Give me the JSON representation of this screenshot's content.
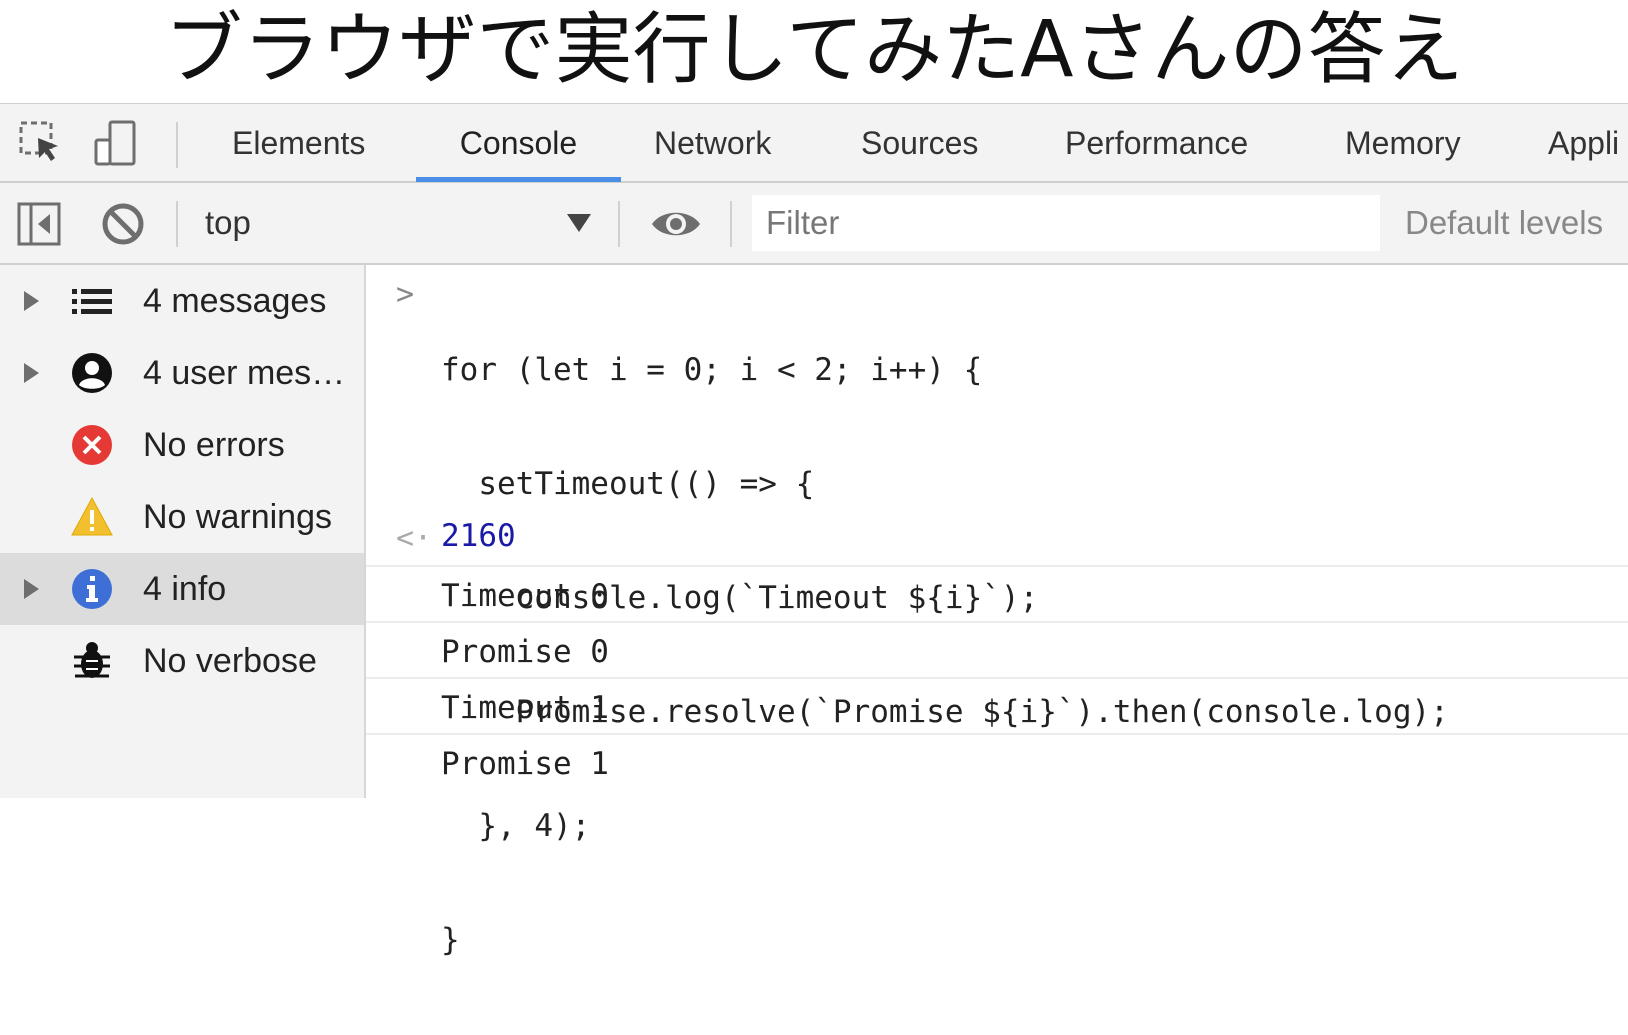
{
  "slide": {
    "title": "ブラウザで実行してみたAさんの答え"
  },
  "devtools": {
    "tabs": [
      "Elements",
      "Console",
      "Network",
      "Sources",
      "Performance",
      "Memory",
      "Appli"
    ],
    "active_tab": "Console",
    "toolbar": {
      "context": "top",
      "filter_placeholder": "Filter",
      "levels": "Default levels"
    },
    "sidebar": [
      {
        "label": "4 messages",
        "icon": "list-icon"
      },
      {
        "label": "4 user mes…",
        "icon": "user-icon"
      },
      {
        "label": "No errors",
        "icon": "error-icon"
      },
      {
        "label": "No warnings",
        "icon": "warning-icon"
      },
      {
        "label": "4 info",
        "icon": "info-icon"
      },
      {
        "label": "No verbose",
        "icon": "bug-icon"
      }
    ],
    "console": {
      "code_lines": [
        "for (let i = 0; i < 2; i++) {",
        "  setTimeout(() => {",
        "    console.log(`Timeout ${i}`);",
        "    Promise.resolve(`Promise ${i}`).then(console.log);",
        "  }, 4);",
        "}"
      ],
      "result": "2160",
      "logs": [
        "Timeout 0",
        "Promise 0",
        "Timeout 1",
        "Promise 1"
      ]
    }
  }
}
